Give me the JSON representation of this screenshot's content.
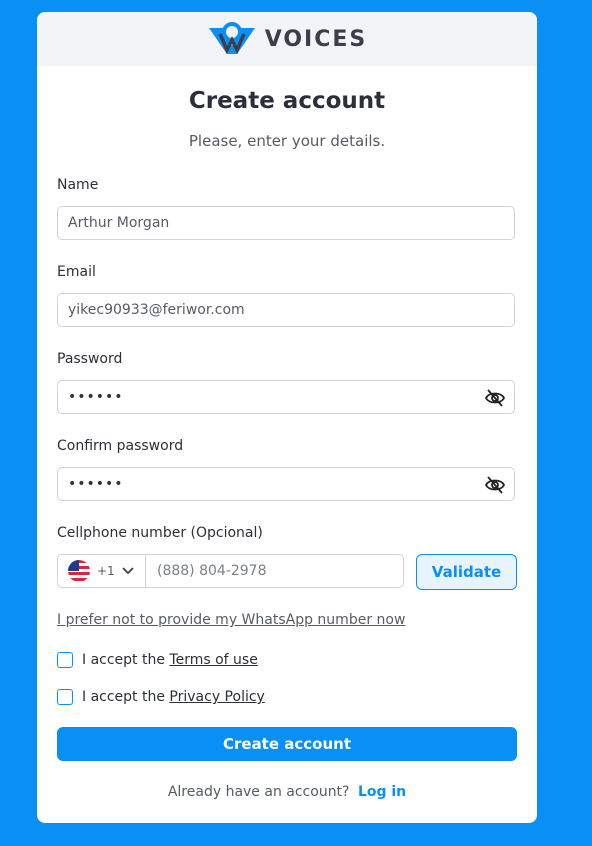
{
  "brand": {
    "name": "VOICES"
  },
  "header": {
    "title": "Create account",
    "subtitle": "Please, enter your details."
  },
  "form": {
    "name_label": "Name",
    "name_value": "Arthur Morgan",
    "email_label": "Email",
    "email_value": "yikec90933@feriwor.com",
    "password_label": "Password",
    "password_value": "••••••",
    "confirm_label": "Confirm password",
    "confirm_value": "••••••",
    "phone_label": "Cellphone number (Opcional)",
    "country_code": "+1",
    "phone_placeholder": "(888) 804-2978",
    "validate_label": "Validate",
    "skip_whatsapp_link": "I prefer not to provide my WhatsApp number now",
    "terms_prefix": "I accept the ",
    "terms_link": "Terms of use",
    "privacy_prefix": "I accept the ",
    "privacy_link": "Privacy Policy",
    "submit_label": "Create account"
  },
  "footer": {
    "prompt": "Already have an account?",
    "login_label": "Log in"
  },
  "colors": {
    "accent": "#0a8ff5",
    "background": "#0a8ff5"
  },
  "icons": {
    "password_toggle": "eye-off-icon",
    "country_flag": "us-flag-icon",
    "dropdown": "chevron-down-icon"
  }
}
